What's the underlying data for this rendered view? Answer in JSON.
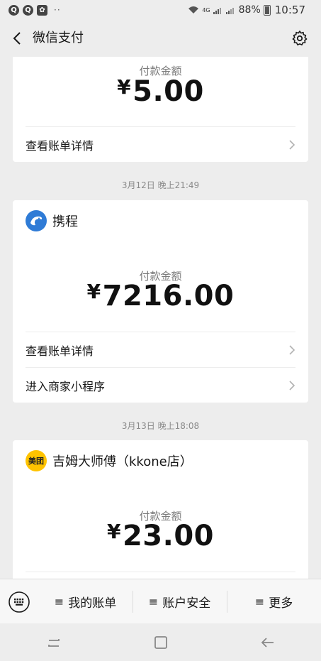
{
  "status_bar": {
    "left_icons": [
      "Q",
      "Q"
    ],
    "dots": "··",
    "network": "4G",
    "battery": "88%",
    "time": "10:57"
  },
  "header": {
    "title": "微信支付"
  },
  "cards": [
    {
      "merchant": null,
      "amount_label": "付款金额",
      "currency": "¥",
      "amount": "5.00",
      "links": [
        "查看账单详情"
      ]
    },
    {
      "timestamp": "3月12日 晚上21:49",
      "merchant": "携程",
      "amount_label": "付款金额",
      "currency": "¥",
      "amount": "7216.00",
      "links": [
        "查看账单详情",
        "进入商家小程序"
      ]
    },
    {
      "timestamp": "3月13日 晚上18:08",
      "merchant": "吉姆大师傅（kkone店）",
      "logo_text": "美团",
      "amount_label": "付款金额",
      "currency": "¥",
      "amount": "23.00"
    }
  ],
  "bottom_menu": {
    "items": [
      {
        "label": "我的账单"
      },
      {
        "label": "账户安全"
      },
      {
        "label": "更多"
      }
    ]
  },
  "colors": {
    "background": "#ededed",
    "card": "#ffffff",
    "ctrip_blue": "#2f7bd6",
    "meituan_yellow": "#ffc300"
  }
}
